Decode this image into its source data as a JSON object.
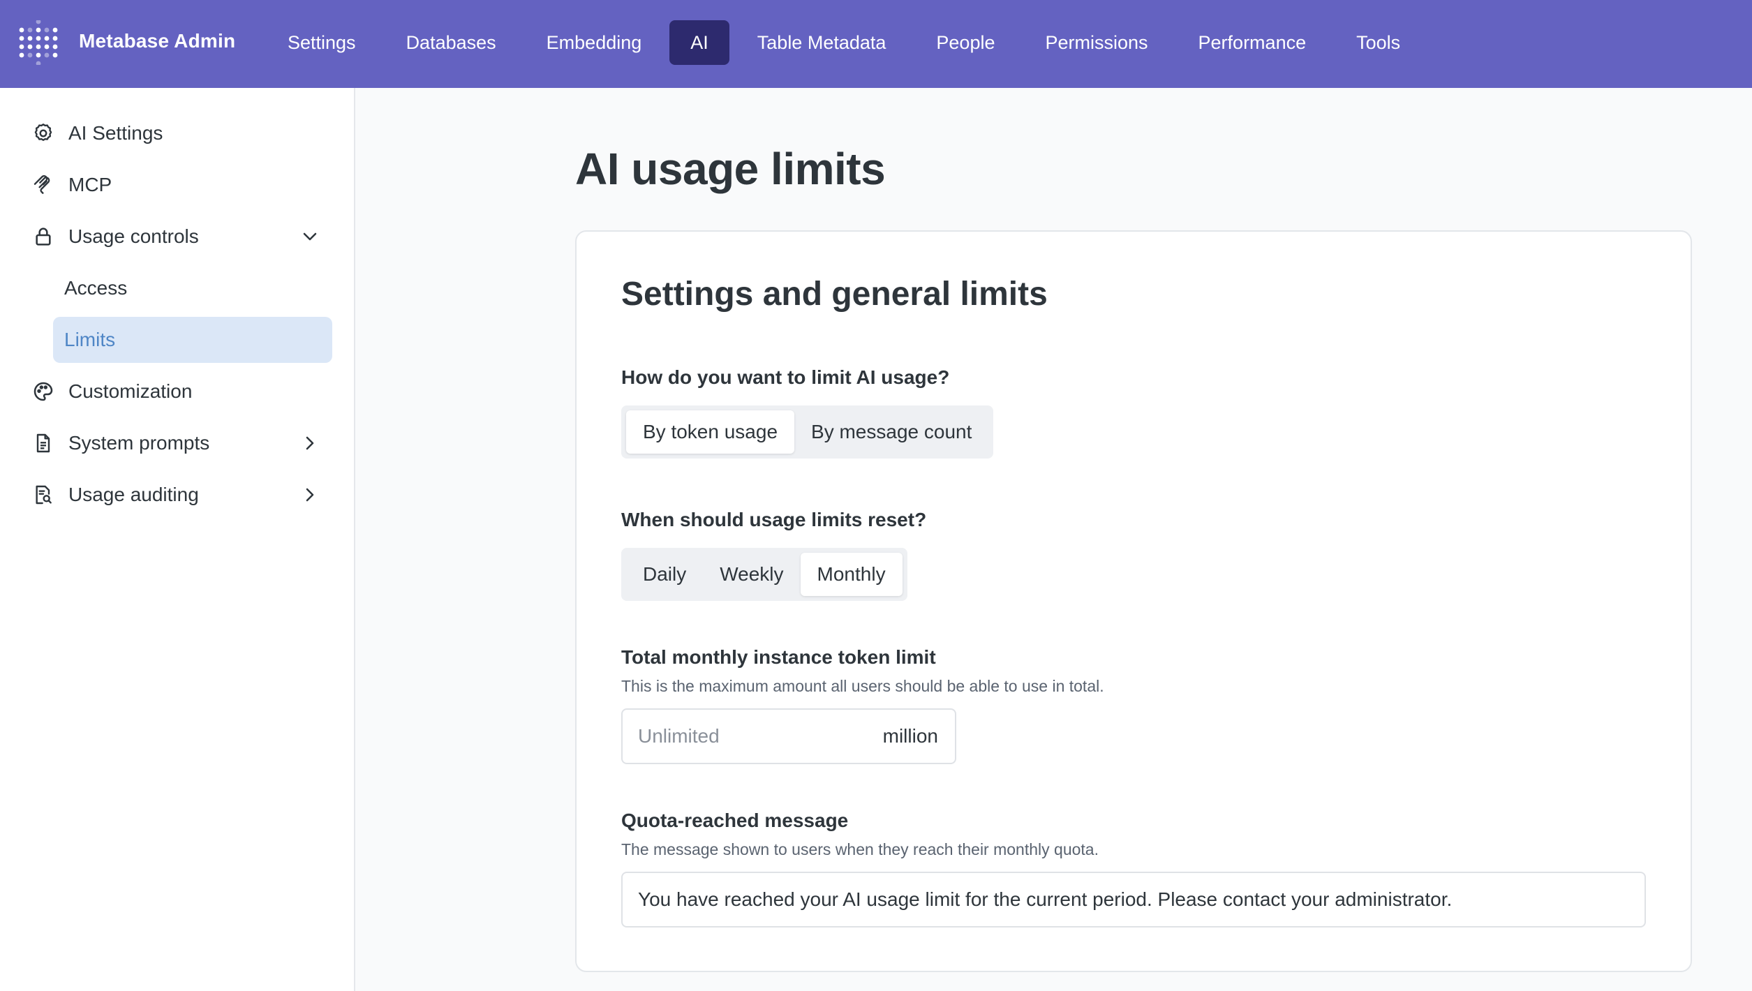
{
  "app": {
    "brand": "Metabase Admin"
  },
  "nav": {
    "items": [
      {
        "label": "Settings"
      },
      {
        "label": "Databases"
      },
      {
        "label": "Embedding"
      },
      {
        "label": "AI",
        "active": true
      },
      {
        "label": "Table Metadata"
      },
      {
        "label": "People"
      },
      {
        "label": "Permissions"
      },
      {
        "label": "Performance"
      },
      {
        "label": "Tools"
      }
    ]
  },
  "sidebar": {
    "items": [
      {
        "label": "AI Settings",
        "icon": "gear-icon"
      },
      {
        "label": "MCP",
        "icon": "mcp-icon"
      },
      {
        "label": "Usage controls",
        "icon": "lock-icon",
        "expanded": true,
        "children": [
          {
            "label": "Access"
          },
          {
            "label": "Limits",
            "active": true
          }
        ]
      },
      {
        "label": "Customization",
        "icon": "palette-icon"
      },
      {
        "label": "System prompts",
        "icon": "document-icon"
      },
      {
        "label": "Usage auditing",
        "icon": "audit-icon"
      }
    ]
  },
  "main": {
    "title": "AI usage limits",
    "card": {
      "title": "Settings and general limits",
      "limit_type": {
        "question": "How do you want to limit AI usage?",
        "options": [
          "By token usage",
          "By message count"
        ],
        "selected": "By token usage"
      },
      "reset_period": {
        "question": "When should usage limits reset?",
        "options": [
          "Daily",
          "Weekly",
          "Monthly"
        ],
        "selected": "Monthly"
      },
      "token_limit": {
        "label": "Total monthly instance token limit",
        "description": "This is the maximum amount all users should be able to use in total.",
        "placeholder": "Unlimited",
        "value": "",
        "suffix": "million"
      },
      "quota_message": {
        "label": "Quota-reached message",
        "description": "The message shown to users when they reach their monthly quota.",
        "value": "You have reached your AI usage limit for the current period. Please contact your administrator."
      }
    }
  },
  "colors": {
    "topbar": "#6462c1",
    "nav_active": "#2d2a6e",
    "sidebar_active_bg": "#dbe7f7",
    "sidebar_active_text": "#4f86c6"
  }
}
